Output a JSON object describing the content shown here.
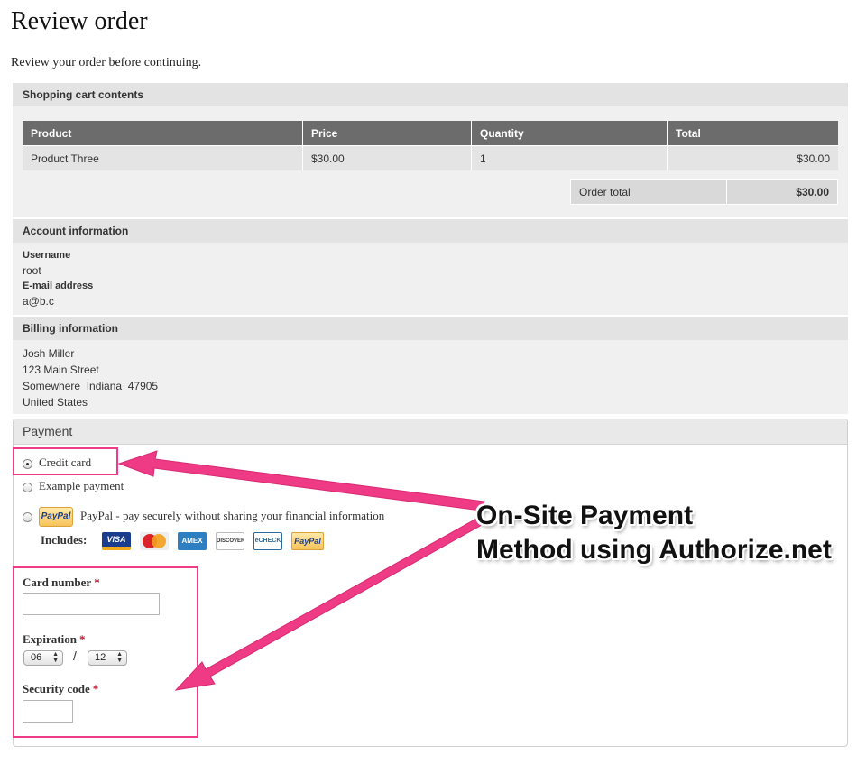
{
  "page": {
    "title": "Review order",
    "intro": "Review your order before continuing."
  },
  "cart": {
    "title": "Shopping cart contents",
    "columns": [
      "Product",
      "Price",
      "Quantity",
      "Total"
    ],
    "rows": [
      {
        "product": "Product Three",
        "price": "$30.00",
        "quantity": "1",
        "total": "$30.00"
      }
    ],
    "order_total_label": "Order total",
    "order_total_value": "$30.00"
  },
  "account": {
    "title": "Account information",
    "username_label": "Username",
    "username": "root",
    "email_label": "E-mail address",
    "email": "a@b.c"
  },
  "billing": {
    "title": "Billing information",
    "lines": [
      "Josh Miller",
      "123 Main Street",
      "Somewhere  Indiana  47905",
      "United States"
    ]
  },
  "payment": {
    "legend": "Payment",
    "options": [
      {
        "label": "Credit card",
        "selected": true
      },
      {
        "label": "Example payment",
        "selected": false
      },
      {
        "label": "PayPal - pay securely without sharing your financial information",
        "selected": false
      }
    ],
    "includes_label": "Includes:",
    "card_logos": [
      {
        "icon": "visa-card-icon",
        "text": "VISA"
      },
      {
        "icon": "mastercard-icon",
        "text": "MasterCard"
      },
      {
        "icon": "amex-card-icon",
        "text": "AMEX"
      },
      {
        "icon": "discover-card-icon",
        "text": "DISCOVER"
      },
      {
        "icon": "echeck-icon",
        "text": "eCHECK"
      },
      {
        "icon": "paypal-card-icon",
        "text": "PayPal"
      }
    ],
    "paypal_logo_text": "PayPal",
    "card_number_label": "Card number",
    "card_number_value": "",
    "expiration_label": "Expiration",
    "exp_month": "06",
    "exp_year": "12",
    "exp_separator": "/",
    "security_code_label": "Security code",
    "security_code_value": "",
    "required_mark": "*"
  },
  "annotation": {
    "line1": "On-Site Payment",
    "line2": "Method using Authorize.net",
    "color": "#ef3a85"
  }
}
